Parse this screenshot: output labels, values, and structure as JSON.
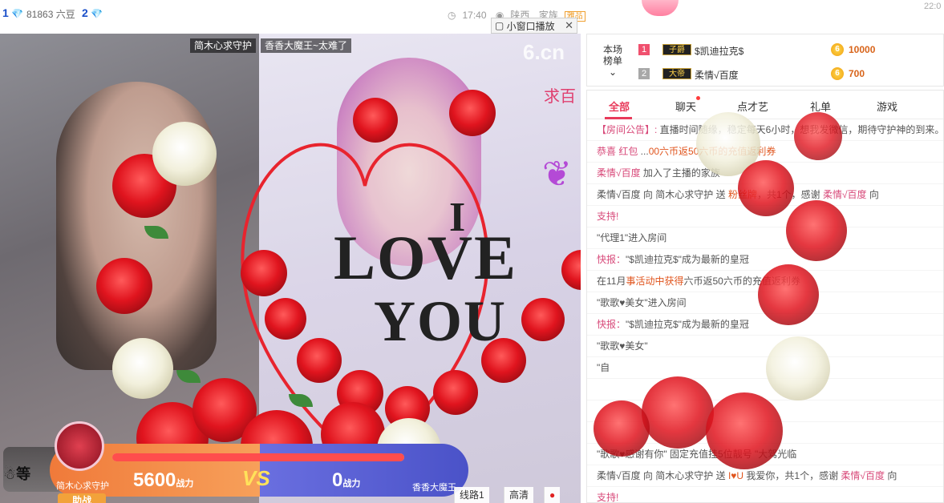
{
  "topbar": {
    "rank1_num": "1",
    "rank1_icon": "diamond-icon",
    "beans": "81863 六豆",
    "rank2_num": "2",
    "time": "17:40",
    "location": "陕西",
    "family": "家族",
    "family_badge": "雅品",
    "mini_window_label": "小窗口播放",
    "right_time": "22:0"
  },
  "video": {
    "left_anchor_tag": "简木心求守护",
    "right_anchor_tag": "香香大魔王~太难了",
    "logo": "6.cn",
    "side_text": "求百",
    "effect_line1": "I",
    "effect_line2": "LOVE",
    "effect_line3": "YOU"
  },
  "pk": {
    "left_name": "简木心求守护",
    "left_score": "5600",
    "score_unit": "战力",
    "vs": "VS",
    "right_score": "0",
    "right_name": "香香大魔王",
    "progress": 1.0,
    "help_label": "助战",
    "wait_label": "等"
  },
  "controls": {
    "line": "线路1",
    "quality": "高清"
  },
  "rank": {
    "title_line1": "本场",
    "title_line2": "榜单",
    "rows": [
      {
        "num": "1",
        "badge": "子爵",
        "name": "$凯迪拉克$",
        "value": "10000",
        "num_color": "#f0506e"
      },
      {
        "num": "2",
        "badge": "大帝",
        "name": "柔情√百度",
        "value": "700",
        "num_color": "#a8a8a8"
      }
    ]
  },
  "chat": {
    "tabs": [
      "全部",
      "聊天",
      "点才艺",
      "礼单",
      "游戏"
    ],
    "messages": [
      {
        "a": "【房间公告】: ",
        "b": "直播时间随缘，稳定每天6小时，想我发微信，期待守护神的到来。"
      },
      {
        "a": "恭喜 红包",
        "b": "  ...",
        "c": "00六币返50六币的充值返利券"
      },
      {
        "a": "柔情√百度",
        "b": " 加入了主播的家族"
      },
      {
        "a": "",
        "b": "柔情√百度 向 简木心求守护 送 ",
        "c": "粉丝牌",
        "d": "，共1个，感谢 ",
        "e": "柔情√百度",
        "f": " 向"
      },
      {
        "a": "支持!",
        "b": ""
      },
      {
        "a": "",
        "b": "\"代理1\"进入房间"
      },
      {
        "a": "快报：",
        "b": "\"$凯迪拉克$\"成为最新的皇冠"
      },
      {
        "a": "",
        "b": "在11月",
        "c": "事活动中获得",
        "d": "六币返50六币的充值返利券"
      },
      {
        "a": "",
        "b": "\"歌歌♥美女\"进入房间"
      },
      {
        "a": "快报：",
        "b": "\"$凯迪拉克$\"成为最新的皇冠"
      },
      {
        "a": "",
        "b": "\"歌歌♥美女\""
      },
      {
        "a": "",
        "b": "\"自"
      },
      {
        "a": "",
        "b": ""
      },
      {
        "a": "",
        "b": ""
      },
      {
        "a": "",
        "b": ""
      },
      {
        "a": "",
        "b": "\"歌歌♥感谢有你\" 固定充值挂5位靓号 \"大驾光临"
      },
      {
        "a": "",
        "b": "柔情√百度 向 简木心求守护 送 ",
        "c": "I♥U",
        "d": " 我爱你，共1个，感谢 ",
        "e": "柔情√百度",
        "f": " 向"
      },
      {
        "a": "支持!",
        "b": ""
      }
    ]
  },
  "colors": {
    "accent": "#e83a5a",
    "pk_left": "#f07a3a",
    "pk_right": "#4a52c8"
  }
}
